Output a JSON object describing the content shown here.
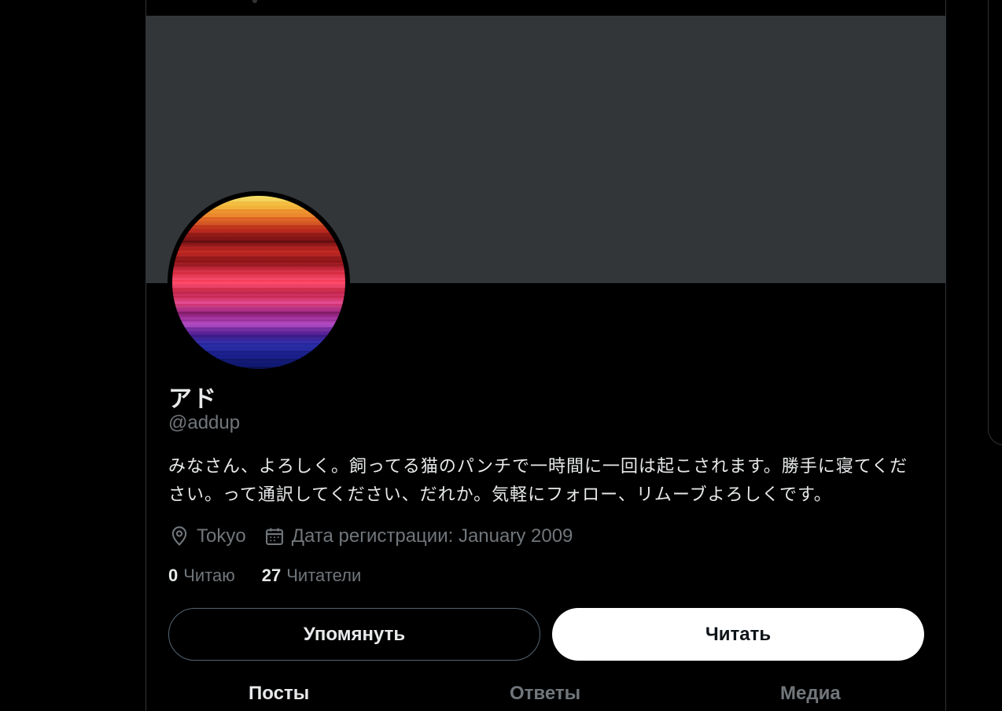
{
  "profile": {
    "display_name": "アド",
    "handle": "@addup",
    "bio": "みなさん、よろしく。飼ってる猫のパンチで一時間に一回は起こされます。勝手に寝てください。って通訳してください、だれか。気軽にフォロー、リムーブよろしくです。",
    "location": "Tokyo",
    "joined": "Дата регистрации: January 2009",
    "location_icon": "map-pin-icon",
    "joined_icon": "calendar-icon"
  },
  "stats": {
    "following_count": "0",
    "following_label": "Читаю",
    "followers_count": "27",
    "followers_label": "Читатели"
  },
  "actions": {
    "mention_label": "Упомянуть",
    "follow_label": "Читать"
  },
  "tabs": [
    {
      "label": "Посты",
      "active": true
    },
    {
      "label": "Ответы",
      "active": false
    },
    {
      "label": "Медиа",
      "active": false
    }
  ],
  "colors": {
    "background": "#000000",
    "banner": "#333639",
    "text_primary": "#e7e9ea",
    "text_secondary": "#71767b",
    "border": "#2f3336",
    "follow_button_bg": "#ffffff"
  }
}
